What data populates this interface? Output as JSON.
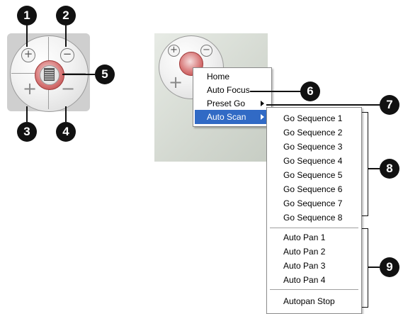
{
  "callouts": [
    "1",
    "2",
    "3",
    "4",
    "5",
    "6",
    "7",
    "8",
    "9"
  ],
  "widget": {
    "mini_plus": "+",
    "mini_minus": "−",
    "big_plus": "+",
    "big_minus": "−"
  },
  "context_menu": {
    "items": [
      {
        "label": "Home",
        "has_submenu": false,
        "selected": false
      },
      {
        "label": "Auto Focus",
        "has_submenu": false,
        "selected": false
      },
      {
        "label": "Preset Go",
        "has_submenu": true,
        "selected": false
      },
      {
        "label": "Auto Scan",
        "has_submenu": true,
        "selected": true
      }
    ]
  },
  "submenu": {
    "sequences": [
      "Go Sequence 1",
      "Go Sequence 2",
      "Go Sequence 3",
      "Go Sequence 4",
      "Go Sequence 5",
      "Go Sequence 6",
      "Go Sequence 7",
      "Go Sequence 8"
    ],
    "pans": [
      "Auto Pan 1",
      "Auto Pan 2",
      "Auto Pan 3",
      "Auto Pan 4"
    ],
    "stop": "Autopan Stop"
  },
  "colors": {
    "selected_bg": "#316ac5",
    "callout_bg": "#111111",
    "center_ring": "#c24a4a"
  }
}
